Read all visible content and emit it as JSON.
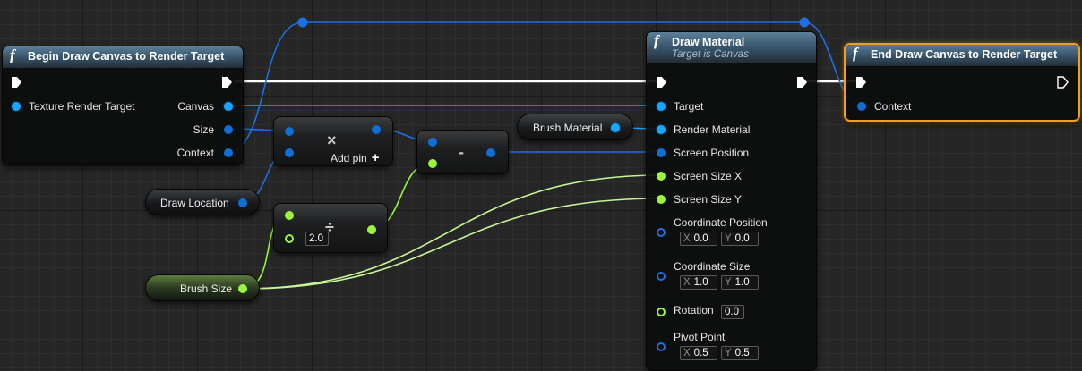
{
  "nodes": {
    "begin": {
      "title": "Begin Draw Canvas to Render Target",
      "inputs": [
        "Texture Render Target"
      ],
      "outputs": [
        "Canvas",
        "Size",
        "Context"
      ]
    },
    "draw_material": {
      "title": "Draw Material",
      "subtitle": "Target is Canvas",
      "inputs": [
        "Target",
        "Render Material",
        "Screen Position",
        "Screen Size X",
        "Screen Size Y",
        "Coordinate Position",
        "Coordinate Size",
        "Rotation",
        "Pivot Point"
      ],
      "coordinate_position": {
        "x": "0.0",
        "y": "0.0"
      },
      "coordinate_size": {
        "x": "1.0",
        "y": "1.0"
      },
      "rotation": "0.0",
      "pivot_point": {
        "x": "0.5",
        "y": "0.5"
      }
    },
    "end": {
      "title": "End Draw Canvas to Render Target",
      "inputs": [
        "Context"
      ]
    },
    "multiply": {
      "symbol": "×",
      "add_pin_label": "Add pin",
      "add_pin_icon": "+"
    },
    "subtract": {
      "symbol": "-"
    },
    "divide": {
      "symbol": "÷",
      "divisor": "2.0"
    },
    "vars": {
      "draw_location": "Draw Location",
      "brush_size": "Brush Size",
      "brush_material": "Brush Material"
    }
  },
  "axis_labels": {
    "x": "X",
    "y": "Y"
  },
  "function_icon": "f",
  "colors": {
    "exec_wire": "#ffffff",
    "object_pin": "#19a6ff",
    "vector_pin": "#1f6fe0",
    "float_pin": "#9bf53c",
    "selected_outline": "#f0a020"
  }
}
